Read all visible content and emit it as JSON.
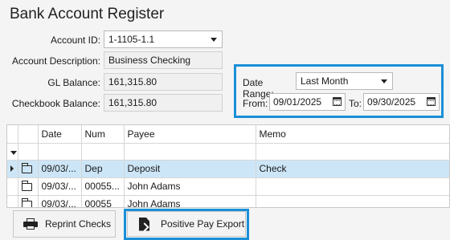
{
  "title": "Bank Account Register",
  "account": {
    "account_id_label": "Account ID:",
    "account_id_value": "1-1105-1.1",
    "description_label": "Account Description:",
    "description_value": "Business Checking",
    "gl_balance_label": "GL Balance:",
    "gl_balance_value": "161,315.80",
    "checkbook_balance_label": "Checkbook Balance:",
    "checkbook_balance_value": "161,315.80"
  },
  "date_range": {
    "label": "Date Range:",
    "value": "Last Month",
    "from_label": "From:",
    "from_value": "09/01/2025",
    "to_label": "To:",
    "to_value": "09/30/2025"
  },
  "grid": {
    "columns": [
      "Date",
      "Num",
      "Payee",
      "Memo"
    ],
    "rows": [
      {
        "date": "09/03/...",
        "num": "Dep",
        "payee": "Deposit",
        "memo": "Check",
        "selected": true
      },
      {
        "date": "09/03/...",
        "num": "00055...",
        "payee": "John Adams",
        "memo": "",
        "selected": false
      },
      {
        "date": "09/03/...",
        "num": "00055",
        "payee": "John Adams",
        "memo": "",
        "selected": false
      }
    ]
  },
  "buttons": {
    "reprint_checks": "Reprint Checks",
    "positive_pay_export": "Positive Pay Export"
  },
  "colors": {
    "highlight": "#1a8fd8",
    "selected_row": "#cde6f7"
  }
}
